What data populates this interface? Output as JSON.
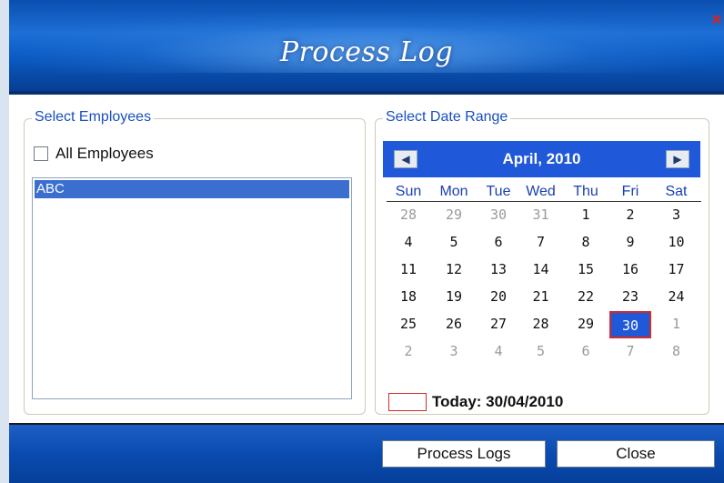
{
  "window": {
    "title": "Process Log",
    "close_glyph": "×"
  },
  "employees": {
    "legend": "Select Employees",
    "all_label": "All Employees",
    "all_checked": false,
    "items": [
      "ABC"
    ]
  },
  "calendar": {
    "legend": "Select Date Range",
    "month_label": "April, 2010",
    "prev_glyph": "◀",
    "next_glyph": "▶",
    "days_of_week": [
      "Sun",
      "Mon",
      "Tue",
      "Wed",
      "Thu",
      "Fri",
      "Sat"
    ],
    "weeks": [
      [
        {
          "d": "28",
          "o": true
        },
        {
          "d": "29",
          "o": true
        },
        {
          "d": "30",
          "o": true
        },
        {
          "d": "31",
          "o": true
        },
        {
          "d": "1"
        },
        {
          "d": "2"
        },
        {
          "d": "3"
        }
      ],
      [
        {
          "d": "4"
        },
        {
          "d": "5"
        },
        {
          "d": "6"
        },
        {
          "d": "7"
        },
        {
          "d": "8"
        },
        {
          "d": "9"
        },
        {
          "d": "10"
        }
      ],
      [
        {
          "d": "11"
        },
        {
          "d": "12"
        },
        {
          "d": "13"
        },
        {
          "d": "14"
        },
        {
          "d": "15"
        },
        {
          "d": "16"
        },
        {
          "d": "17"
        }
      ],
      [
        {
          "d": "18"
        },
        {
          "d": "19"
        },
        {
          "d": "20"
        },
        {
          "d": "21"
        },
        {
          "d": "22"
        },
        {
          "d": "23"
        },
        {
          "d": "24"
        }
      ],
      [
        {
          "d": "25"
        },
        {
          "d": "26"
        },
        {
          "d": "27"
        },
        {
          "d": "28"
        },
        {
          "d": "29"
        },
        {
          "d": "30",
          "sel": true
        },
        {
          "d": "1",
          "o": true
        }
      ],
      [
        {
          "d": "2",
          "o": true
        },
        {
          "d": "3",
          "o": true
        },
        {
          "d": "4",
          "o": true
        },
        {
          "d": "5",
          "o": true
        },
        {
          "d": "6",
          "o": true
        },
        {
          "d": "7",
          "o": true
        },
        {
          "d": "8",
          "o": true
        }
      ]
    ],
    "today_label": "Today: 30/04/2010"
  },
  "footer": {
    "process_label": "Process Logs",
    "close_label": "Close"
  },
  "colors": {
    "accent": "#1f58d8",
    "selection_border": "#d22a2a",
    "legend_text": "#1a4fbf"
  }
}
